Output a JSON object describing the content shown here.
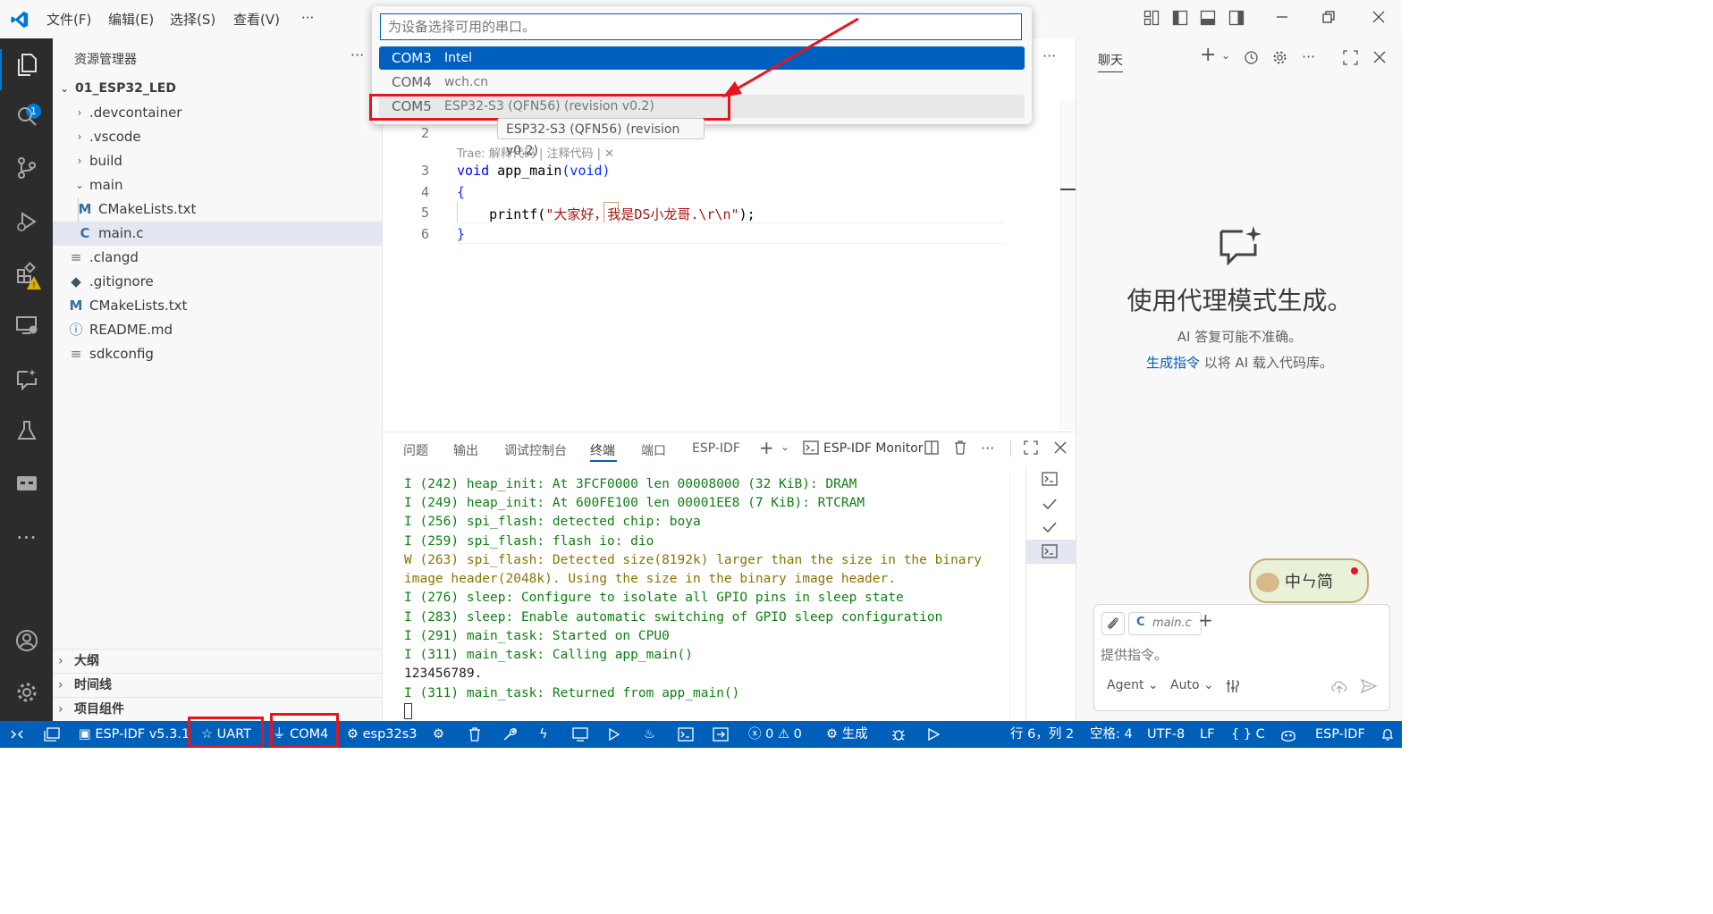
{
  "titlebar": {
    "menus": [
      "文件(F)",
      "编辑(E)",
      "选择(S)",
      "查看(V)",
      "···"
    ]
  },
  "activity": {
    "badge": "1"
  },
  "sidebar": {
    "title": "资源管理器",
    "more": "···",
    "root": "01_ESP32_LED",
    "items": [
      {
        "label": ".devcontainer"
      },
      {
        "label": ".vscode"
      },
      {
        "label": "build"
      },
      {
        "label": "main"
      },
      {
        "label": "CMakeLists.txt"
      },
      {
        "label": "main.c"
      },
      {
        "label": ".clangd"
      },
      {
        "label": ".gitignore"
      },
      {
        "label": "CMakeLists.txt"
      },
      {
        "label": "README.md"
      },
      {
        "label": "sdkconfig"
      }
    ],
    "sections": [
      "大纲",
      "时间线",
      "项目组件"
    ]
  },
  "quickpick": {
    "placeholder": "为设备选择可用的串口。",
    "items": [
      {
        "port": "COM3",
        "desc": "Intel"
      },
      {
        "port": "COM4",
        "desc": "wch.cn"
      },
      {
        "port": "COM5",
        "desc": "ESP32-S3 (QFN56) (revision v0.2)"
      }
    ],
    "tooltip": "ESP32-S3 (QFN56) (revision v0.2)"
  },
  "editor": {
    "codelens": "Trae: 解释代码 | 注释代码 | ✕",
    "lines": [
      {
        "n": "2",
        "text": ""
      },
      {
        "n": "3",
        "kw": "void",
        "fn": " app_main",
        "rest": "(void)"
      },
      {
        "n": "4",
        "text": "{"
      },
      {
        "n": "5",
        "pre": "    printf(",
        "str": "\"大家好，我是DS小龙哥.\\r\\n\"",
        "post": ");"
      },
      {
        "n": "6",
        "text": "}"
      }
    ],
    "more": "···"
  },
  "panel": {
    "tabs": [
      "问题",
      "输出",
      "调试控制台",
      "终端",
      "端口",
      "ESP-IDF"
    ],
    "terminal_name": "ESP-IDF Monitor",
    "lines": [
      {
        "t": "I (242) heap_init: At 3FCF0000 len 00008000 (32 KiB): DRAM",
        "c": "#0f7f12"
      },
      {
        "t": "I (249) heap_init: At 600FE100 len 00001EE8 (7 KiB): RTCRAM",
        "c": "#0f7f12"
      },
      {
        "t": "I (256) spi_flash: detected chip: boya",
        "c": "#0f7f12"
      },
      {
        "t": "I (259) spi_flash: flash io: dio",
        "c": "#0f7f12"
      },
      {
        "t": "W (263) spi_flash: Detected size(8192k) larger than the size in the binary",
        "c": "#8a7400"
      },
      {
        "t": "image header(2048k). Using the size in the binary image header.",
        "c": "#8a7400"
      },
      {
        "t": "I (276) sleep: Configure to isolate all GPIO pins in sleep state",
        "c": "#0f7f12"
      },
      {
        "t": "I (283) sleep: Enable automatic switching of GPIO sleep configuration",
        "c": "#0f7f12"
      },
      {
        "t": "I (291) main_task: Started on CPU0",
        "c": "#0f7f12"
      },
      {
        "t": "I (311) main_task: Calling app_main()",
        "c": "#0f7f12"
      },
      {
        "t": "123456789.",
        "c": "#1f1f1f"
      },
      {
        "t": "I (311) main_task: Returned from app_main()",
        "c": "#0f7f12"
      }
    ]
  },
  "chat": {
    "title": "聊天",
    "heading": "使用代理模式生成。",
    "note": "AI 答复可能不准确。",
    "link": "生成指令",
    "link_rest": " 以将 AI 载入代码库。",
    "context_file": "main.c",
    "input_placeholder": "提供指令。",
    "mode": "Agent",
    "model": "Auto",
    "watermark": "中ㄣ简"
  },
  "statusbar": {
    "idf": "ESP-IDF v5.3.1",
    "uart": "UART",
    "com": "COM4",
    "target": "esp32s3",
    "errors": "0",
    "warnings": "0",
    "build": "生成",
    "position": "行 6，列 2",
    "spaces": "空格: 4",
    "encoding": "UTF-8",
    "eol": "LF",
    "lang": "{ } C",
    "ext": "ESP-IDF"
  },
  "colors": {
    "accent": "#005fb8",
    "highlight": "#e8141b",
    "statusbar": "#005fb8"
  }
}
